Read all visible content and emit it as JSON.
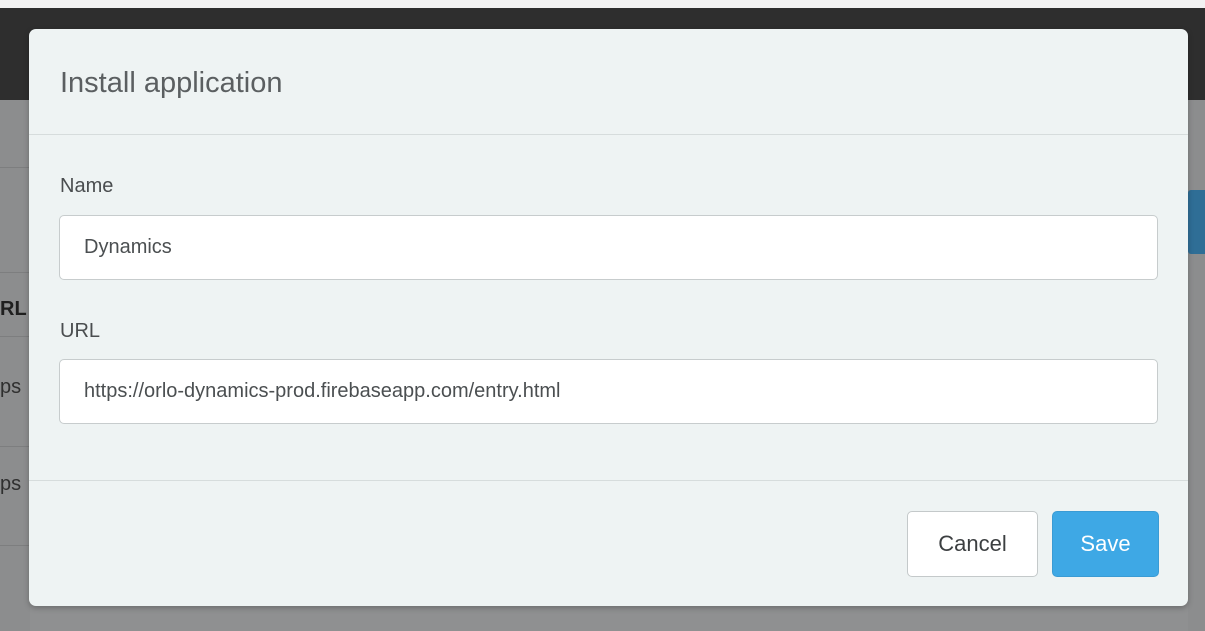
{
  "background": {
    "left_fragments": [
      "RL",
      "ps",
      "ps"
    ]
  },
  "modal": {
    "title": "Install application",
    "fields": [
      {
        "label": "Name",
        "value": "Dynamics"
      },
      {
        "label": "URL",
        "value": "https://orlo-dynamics-prod.firebaseapp.com/entry.html"
      }
    ],
    "buttons": {
      "cancel": "Cancel",
      "save": "Save"
    }
  },
  "colors": {
    "primary": "#3ea8e5",
    "modal_background": "#eef3f3",
    "overlay": "#8f9091"
  }
}
